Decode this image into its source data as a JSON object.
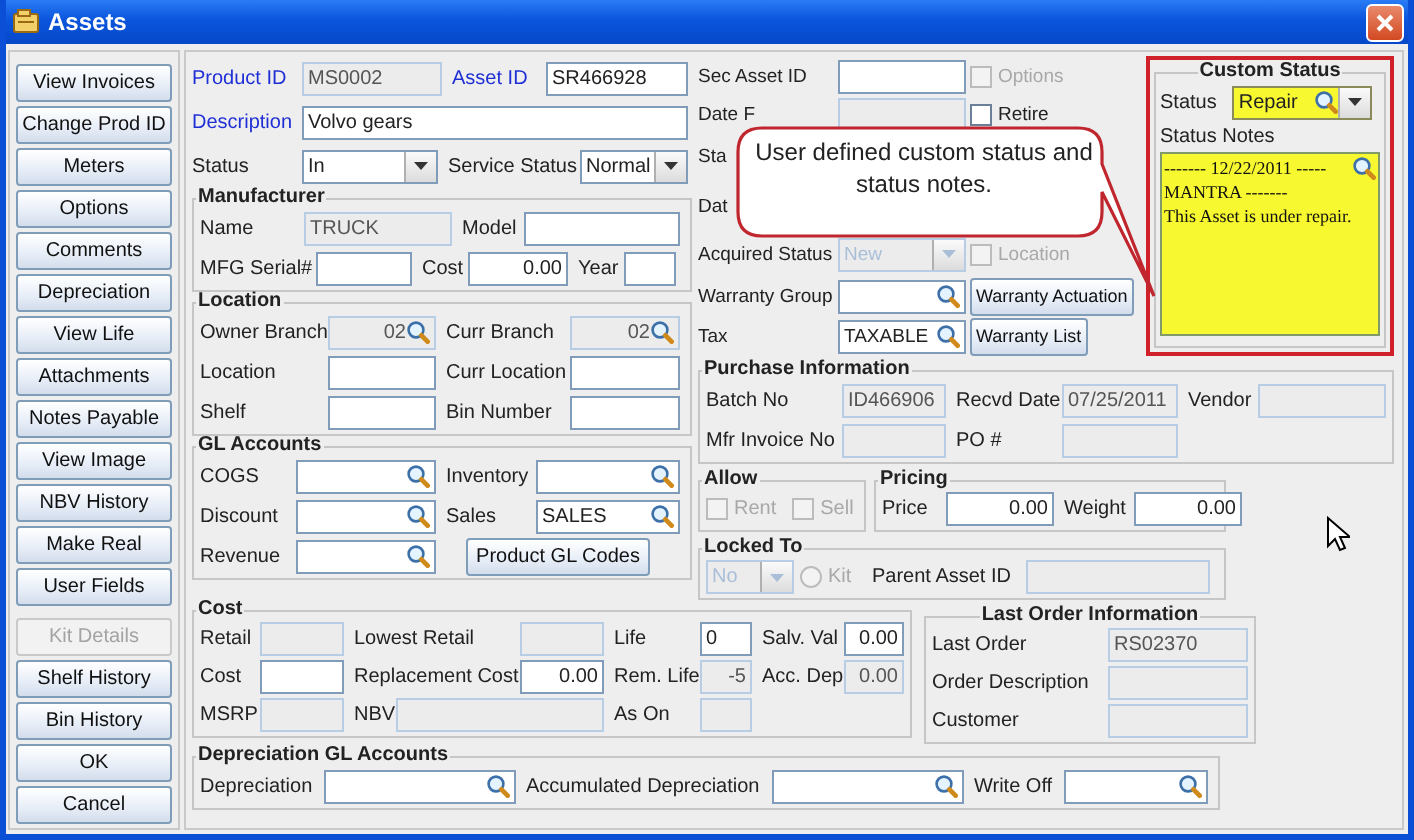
{
  "window": {
    "title": "Assets"
  },
  "side_buttons": [
    {
      "label": "View Invoices",
      "disabled": false
    },
    {
      "label": "Change Prod ID",
      "disabled": false
    },
    {
      "label": "Meters",
      "disabled": false
    },
    {
      "label": "Options",
      "disabled": false
    },
    {
      "label": "Comments",
      "disabled": false
    },
    {
      "label": "Depreciation",
      "disabled": false
    },
    {
      "label": "View Life",
      "disabled": false
    },
    {
      "label": "Attachments",
      "disabled": false
    },
    {
      "label": "Notes Payable",
      "disabled": false
    },
    {
      "label": "View Image",
      "disabled": false
    },
    {
      "label": "NBV History",
      "disabled": false
    },
    {
      "label": "Make Real",
      "disabled": false
    },
    {
      "label": "User Fields",
      "disabled": false
    },
    {
      "label": "Kit Details",
      "disabled": true
    },
    {
      "label": "Shelf History",
      "disabled": false
    },
    {
      "label": "Bin History",
      "disabled": false
    },
    {
      "label": "OK",
      "disabled": false
    },
    {
      "label": "Cancel",
      "disabled": false
    }
  ],
  "header": {
    "rows": [
      [
        {
          "kind": "key_label",
          "text": "Product ID"
        },
        {
          "kind": "text",
          "value": "MS0002",
          "disabled": true
        },
        {
          "kind": "key_label",
          "text": "Asset ID"
        },
        {
          "kind": "text",
          "value": "SR466928",
          "disabled": false
        }
      ],
      [
        {
          "kind": "key_label",
          "text": "Description"
        },
        {
          "kind": "text",
          "value": "Volvo gears",
          "disabled": false
        }
      ],
      [
        {
          "kind": "label",
          "text": "Status"
        },
        {
          "kind": "combo",
          "value": "In",
          "disabled": false
        },
        {
          "kind": "label",
          "text": "Service Status"
        },
        {
          "kind": "combo",
          "value": "Normal",
          "disabled": false
        }
      ]
    ]
  },
  "manufacturer": {
    "title": "Manufacturer",
    "rows": [
      [
        {
          "kind": "label",
          "text": "Name"
        },
        {
          "kind": "text",
          "value": "TRUCK",
          "disabled": true
        },
        {
          "kind": "label",
          "text": "Model"
        },
        {
          "kind": "text",
          "disabled": false
        }
      ],
      [
        {
          "kind": "label",
          "text": "MFG Serial#"
        },
        {
          "kind": "text",
          "disabled": false
        },
        {
          "kind": "label",
          "text": "Cost"
        },
        {
          "kind": "text",
          "value": "0.00",
          "disabled": false
        },
        {
          "kind": "label",
          "text": "Year"
        },
        {
          "kind": "text",
          "disabled": false
        }
      ]
    ]
  },
  "location": {
    "title": "Location",
    "rows": [
      [
        {
          "kind": "label",
          "text": "Owner Branch"
        },
        {
          "kind": "lookup",
          "value": "02",
          "disabled": true
        },
        {
          "kind": "label",
          "text": "Curr Branch"
        },
        {
          "kind": "lookup",
          "value": "02",
          "disabled": true
        }
      ],
      [
        {
          "kind": "label",
          "text": "Location"
        },
        {
          "kind": "text",
          "disabled": false
        },
        {
          "kind": "label",
          "text": "Curr Location"
        },
        {
          "kind": "text",
          "disabled": false
        }
      ],
      [
        {
          "kind": "label",
          "text": "Shelf"
        },
        {
          "kind": "text",
          "disabled": false
        },
        {
          "kind": "label",
          "text": "Bin Number"
        },
        {
          "kind": "text",
          "disabled": false
        }
      ]
    ]
  },
  "gl_accounts": {
    "title": "GL Accounts",
    "rows": [
      [
        {
          "kind": "label",
          "text": "COGS"
        },
        {
          "kind": "lookup",
          "disabled": false
        },
        {
          "kind": "label",
          "text": "Inventory"
        },
        {
          "kind": "lookup",
          "disabled": false
        }
      ],
      [
        {
          "kind": "label",
          "text": "Discount"
        },
        {
          "kind": "lookup",
          "disabled": false
        },
        {
          "kind": "label",
          "text": "Sales"
        },
        {
          "kind": "lookup",
          "value": "SALES",
          "disabled": false
        }
      ],
      [
        {
          "kind": "label",
          "text": "Revenue"
        },
        {
          "kind": "lookup",
          "disabled": false
        },
        {
          "kind": "button",
          "label": "Product GL Codes",
          "disabled": false
        }
      ]
    ]
  },
  "side_fields": {
    "rows": [
      [
        {
          "kind": "label",
          "text": "Sec Asset ID"
        },
        {
          "kind": "text",
          "disabled": false
        },
        {
          "kind": "checkbox",
          "label": "Options",
          "checked": false,
          "disabled": true
        }
      ],
      [
        {
          "kind": "label",
          "text": "Date F"
        },
        {
          "kind": "text",
          "disabled": true
        },
        {
          "kind": "checkbox",
          "label": "Retire",
          "checked": false,
          "disabled": false
        }
      ],
      [
        {
          "kind": "label",
          "text": "Sta"
        }
      ],
      [
        {
          "kind": "label",
          "text": "Dat"
        }
      ],
      [
        {
          "kind": "label",
          "text": "Acquired Status"
        },
        {
          "kind": "combo",
          "value": "New",
          "disabled": true
        },
        {
          "kind": "checkbox",
          "label": "Location",
          "checked": false,
          "disabled": true
        }
      ],
      [
        {
          "kind": "label",
          "text": "Warranty Group"
        },
        {
          "kind": "lookup",
          "disabled": false
        },
        {
          "kind": "button",
          "label": "Warranty Actuation",
          "disabled": false
        }
      ],
      [
        {
          "kind": "label",
          "text": "Tax"
        },
        {
          "kind": "lookup",
          "value": "TAXABLE",
          "disabled": false
        },
        {
          "kind": "button",
          "label": "Warranty List",
          "disabled": false
        }
      ]
    ]
  },
  "custom_status": {
    "title": "Custom Status",
    "status_label": "Status",
    "status_value": "Repair",
    "notes_label": "Status Notes",
    "notes": [
      "------- 12/22/2011 -----",
      "MANTRA -------",
      "This Asset is under repair."
    ]
  },
  "purchase_information": {
    "title": "Purchase Information",
    "rows": [
      [
        {
          "kind": "label",
          "text": "Batch No"
        },
        {
          "kind": "text",
          "value": "ID466906",
          "disabled": true
        },
        {
          "kind": "label",
          "text": "Recvd Date"
        },
        {
          "kind": "text",
          "value": "07/25/2011",
          "disabled": true
        },
        {
          "kind": "label",
          "text": "Vendor"
        },
        {
          "kind": "text",
          "disabled": true
        }
      ],
      [
        {
          "kind": "label",
          "text": "Mfr Invoice No"
        },
        {
          "kind": "text",
          "disabled": true
        },
        {
          "kind": "label",
          "text": "PO #"
        },
        {
          "kind": "text",
          "disabled": true
        }
      ]
    ]
  },
  "allow": {
    "title": "Allow",
    "rows": [
      [
        {
          "kind": "checkbox",
          "label": "Rent",
          "checked": false,
          "disabled": true
        },
        {
          "kind": "checkbox",
          "label": "Sell",
          "checked": false,
          "disabled": true
        }
      ]
    ]
  },
  "pricing": {
    "title": "Pricing",
    "rows": [
      [
        {
          "kind": "label",
          "text": "Price"
        },
        {
          "kind": "text",
          "value": "0.00",
          "disabled": false
        },
        {
          "kind": "label",
          "text": "Weight"
        },
        {
          "kind": "text",
          "value": "0.00",
          "disabled": false
        }
      ]
    ]
  },
  "locked_to": {
    "title": "Locked To",
    "rows": [
      [
        {
          "kind": "combo",
          "value": "No",
          "disabled": true
        },
        {
          "kind": "radio",
          "label": "Kit",
          "selected": false,
          "disabled": true
        },
        {
          "kind": "label",
          "text": "Parent Asset ID"
        },
        {
          "kind": "text",
          "disabled": true
        }
      ]
    ]
  },
  "cost": {
    "title": "Cost",
    "rows": [
      [
        {
          "kind": "label",
          "text": "Retail"
        },
        {
          "kind": "text",
          "disabled": true
        },
        {
          "kind": "label",
          "text": "Lowest Retail"
        },
        {
          "kind": "text",
          "disabled": true
        },
        {
          "kind": "label",
          "text": "Life"
        },
        {
          "kind": "text",
          "value": "0",
          "disabled": false
        },
        {
          "kind": "label",
          "text": "Salv. Val"
        },
        {
          "kind": "text",
          "value": "0.00",
          "disabled": false
        }
      ],
      [
        {
          "kind": "label",
          "text": "Cost"
        },
        {
          "kind": "text",
          "disabled": false
        },
        {
          "kind": "label",
          "text": "Replacement Cost"
        },
        {
          "kind": "text",
          "value": "0.00",
          "disabled": false
        },
        {
          "kind": "label",
          "text": "Rem. Life"
        },
        {
          "kind": "text",
          "value": "-5",
          "disabled": true
        },
        {
          "kind": "label",
          "text": "Acc. Dep"
        },
        {
          "kind": "text",
          "value": "0.00",
          "disabled": true
        }
      ],
      [
        {
          "kind": "label",
          "text": "MSRP"
        },
        {
          "kind": "text",
          "disabled": true
        },
        {
          "kind": "label",
          "text": "NBV"
        },
        {
          "kind": "text",
          "disabled": true
        },
        {
          "kind": "label",
          "text": "As On"
        },
        {
          "kind": "text",
          "disabled": true
        }
      ]
    ]
  },
  "last_order_information": {
    "title": "Last Order Information",
    "rows": [
      [
        {
          "kind": "label",
          "text": "Last Order"
        },
        {
          "kind": "text",
          "value": "RS02370",
          "disabled": true
        }
      ],
      [
        {
          "kind": "label",
          "text": "Order Description"
        },
        {
          "kind": "text",
          "disabled": true
        }
      ],
      [
        {
          "kind": "label",
          "text": "Customer"
        },
        {
          "kind": "text",
          "disabled": true
        }
      ]
    ]
  },
  "depreciation_gl_accounts": {
    "title": "Depreciation GL Accounts",
    "rows": [
      [
        {
          "kind": "label",
          "text": "Depreciation"
        },
        {
          "kind": "lookup",
          "disabled": false
        },
        {
          "kind": "label",
          "text": "Accumulated Depreciation"
        },
        {
          "kind": "lookup",
          "disabled": false
        },
        {
          "kind": "label",
          "text": "Write Off"
        },
        {
          "kind": "lookup",
          "disabled": false
        }
      ]
    ]
  },
  "callout": {
    "text": "User defined custom status and status notes."
  }
}
